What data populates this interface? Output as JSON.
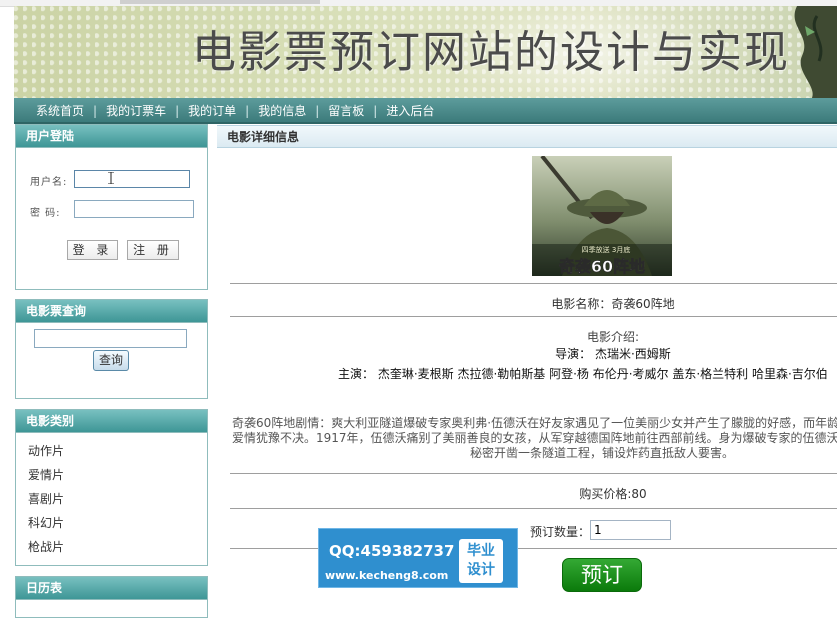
{
  "banner": {
    "title": "电影票预订网站的设计与实现"
  },
  "nav": {
    "items": [
      "系统首页",
      "我的订票车",
      "我的订单",
      "我的信息",
      "留言板",
      "进入后台"
    ],
    "separator": "|"
  },
  "login": {
    "title": "用户登陆",
    "username_label": "用户名:",
    "password_label": "密  码:",
    "username_value": "",
    "password_value": "",
    "login_button": "登 录",
    "register_button": "注 册"
  },
  "query": {
    "title": "电影票查询",
    "input_value": "",
    "button": "查询"
  },
  "categories": {
    "title": "电影类别",
    "items": [
      "动作片",
      "爱情片",
      "喜剧片",
      "科幻片",
      "枪战片"
    ]
  },
  "calendar": {
    "title": "日历表"
  },
  "detail": {
    "header": "电影详细信息",
    "poster_caption": "奇袭60阵地",
    "poster_small_text": "四季放送 3月底",
    "name_line": "电影名称：奇袭60阵地",
    "intro_label": "电影介绍:",
    "director_line": "导演： 杰瑞米·西姆斯",
    "actors_line": "主演： 杰奎琳·麦根斯 杰拉德·勒帕斯基 阿登·杨 布伦丹·考威尔 盖东·格兰特利 哈里森·吉尔伯",
    "plot_line1": "奇袭60阵地剧情：爽大利亚隧道爆破专家奥利弗·伍德沃在好友家遇见了一位美丽少女并产生了朦胧的好感，而年龄",
    "plot_line2": "爱情犹豫不决。1917年，伍德沃痛别了美丽善良的女孩，从军穿越德国阵地前往西部前线。身为爆破专家的伍德沃",
    "plot_line3": "秘密开凿一条隧道工程，铺设炸药直抵敌人要害。",
    "price_line": "购买价格:80",
    "qty_label": "预订数量：",
    "qty_value": "1",
    "order_button": "预订"
  },
  "watermark": {
    "qq": "QQ:459382737",
    "site": "www.kecheng8.com",
    "badge_line1": "毕业",
    "badge_line2": "设计"
  },
  "colors": {
    "nav_bg": "#3c7b7b",
    "panel_header": "#4aa3a3",
    "order_button": "#1a8a1a",
    "watermark_bg": "#2f8fcf"
  }
}
